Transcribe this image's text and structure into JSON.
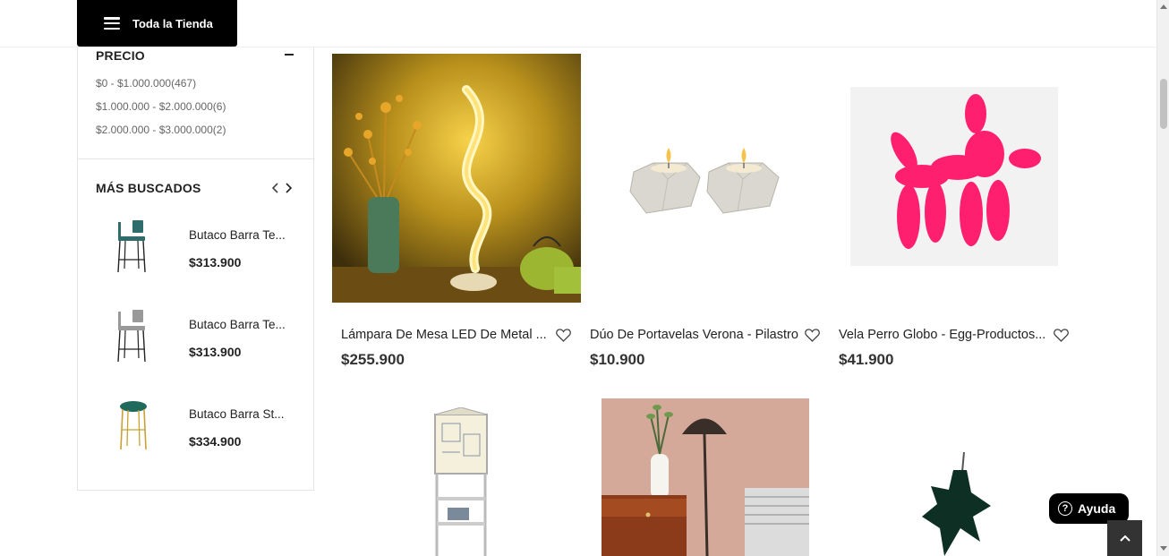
{
  "header": {
    "menu_label": "Toda la Tienda"
  },
  "sidebar": {
    "price": {
      "title": "PRECIO",
      "ranges": [
        {
          "label": "$0 - $1.000.000",
          "count": "(467)"
        },
        {
          "label": "$1.000.000 - $2.000.000",
          "count": "(6)"
        },
        {
          "label": "$2.000.000 - $3.000.000",
          "count": "(2)"
        }
      ]
    },
    "best": {
      "title": "MÁS BUSCADOS",
      "items": [
        {
          "name": "Butaco Barra Te...",
          "price": "$313.900",
          "seat_color": "#2f6d6c"
        },
        {
          "name": "Butaco Barra Te...",
          "price": "$313.900",
          "seat_color": "#9a9a9a"
        },
        {
          "name": "Butaco Barra St...",
          "price": "$334.900",
          "seat_color": "#1f6a5a"
        }
      ]
    }
  },
  "products": [
    {
      "title": "Lámpara De Mesa LED De Metal ...",
      "price": "$255.900"
    },
    {
      "title": "Dúo De Portavelas Verona - Pilastro",
      "price": "$10.900"
    },
    {
      "title": "Vela Perro Globo - Egg-Productos...",
      "price": "$41.900"
    }
  ],
  "help": {
    "label": "Ayuda"
  },
  "colors": {
    "accent": "#000000",
    "balloon_dog": "#ff1f6e"
  }
}
